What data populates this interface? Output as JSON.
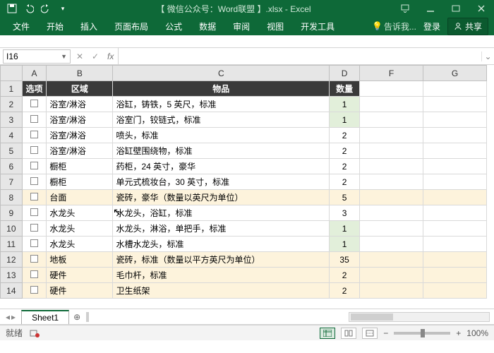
{
  "titlebar": {
    "title": "【 微信公众号：Word联盟 】.xlsx - Excel"
  },
  "ribbon": {
    "tabs": [
      "文件",
      "开始",
      "插入",
      "页面布局",
      "公式",
      "数据",
      "审阅",
      "视图",
      "开发工具"
    ],
    "tell": "告诉我...",
    "login": "登录",
    "share": "共享"
  },
  "formula_bar": {
    "namebox": "I16",
    "fx": "fx",
    "formula": ""
  },
  "columns": [
    "A",
    "B",
    "C",
    "D",
    "F",
    "G"
  ],
  "header_row": {
    "A": "选项",
    "B": "区域",
    "C": "物品",
    "D": "数量"
  },
  "rows": [
    {
      "n": 2,
      "B": "浴室/淋浴",
      "C": "浴缸，铸铁，5 英尺，标准",
      "D": "1",
      "hl": "grn"
    },
    {
      "n": 3,
      "B": "浴室/淋浴",
      "C": "浴室门，铰链式，标准",
      "D": "1",
      "hl": "grn"
    },
    {
      "n": 4,
      "B": "浴室/淋浴",
      "C": "喷头，标准",
      "D": "2",
      "hl": ""
    },
    {
      "n": 5,
      "B": "浴室/淋浴",
      "C": "浴缸壁围绕物，标准",
      "D": "2",
      "hl": ""
    },
    {
      "n": 6,
      "B": "橱柜",
      "C": "药柜，24 英寸，豪华",
      "D": "2",
      "hl": ""
    },
    {
      "n": 7,
      "B": "橱柜",
      "C": "单元式梳妆台，30 英寸，标准",
      "D": "2",
      "hl": ""
    },
    {
      "n": 8,
      "B": "台面",
      "C": "瓷砖，豪华（数量以英尺为单位）",
      "D": "5",
      "hl": "yel"
    },
    {
      "n": 9,
      "B": "水龙头",
      "C": "水龙头，浴缸，标准",
      "D": "3",
      "hl": ""
    },
    {
      "n": 10,
      "B": "水龙头",
      "C": "水龙头，淋浴，单把手，标准",
      "D": "1",
      "hl": "grn"
    },
    {
      "n": 11,
      "B": "水龙头",
      "C": "水槽水龙头，标准",
      "D": "1",
      "hl": "grn"
    },
    {
      "n": 12,
      "B": "地板",
      "C": "瓷砖，标准（数量以平方英尺为单位）",
      "D": "35",
      "hl": "yel"
    },
    {
      "n": 13,
      "B": "硬件",
      "C": "毛巾杆，标准",
      "D": "2",
      "hl": "yel"
    },
    {
      "n": 14,
      "B": "硬件",
      "C": "卫生纸架",
      "D": "2",
      "hl": "yel"
    }
  ],
  "sheet": {
    "name": "Sheet1"
  },
  "status": {
    "ready": "就绪",
    "macro_hint": "",
    "zoom_minus": "−",
    "zoom_plus": "+",
    "zoom": "100%"
  },
  "chart_data": {
    "type": "table",
    "columns": [
      "选项",
      "区域",
      "物品",
      "数量"
    ],
    "rows": [
      [
        "",
        "浴室/淋浴",
        "浴缸，铸铁，5 英尺，标准",
        1
      ],
      [
        "",
        "浴室/淋浴",
        "浴室门，铰链式，标准",
        1
      ],
      [
        "",
        "浴室/淋浴",
        "喷头，标准",
        2
      ],
      [
        "",
        "浴室/淋浴",
        "浴缸壁围绕物，标准",
        2
      ],
      [
        "",
        "橱柜",
        "药柜，24 英寸，豪华",
        2
      ],
      [
        "",
        "橱柜",
        "单元式梳妆台，30 英寸，标准",
        2
      ],
      [
        "",
        "台面",
        "瓷砖，豪华（数量以英尺为单位）",
        5
      ],
      [
        "",
        "水龙头",
        "水龙头，浴缸，标准",
        3
      ],
      [
        "",
        "水龙头",
        "水龙头，淋浴，单把手，标准",
        1
      ],
      [
        "",
        "水龙头",
        "水槽水龙头，标准",
        1
      ],
      [
        "",
        "地板",
        "瓷砖，标准（数量以平方英尺为单位）",
        35
      ],
      [
        "",
        "硬件",
        "毛巾杆，标准",
        2
      ],
      [
        "",
        "硬件",
        "卫生纸架",
        2
      ]
    ]
  }
}
